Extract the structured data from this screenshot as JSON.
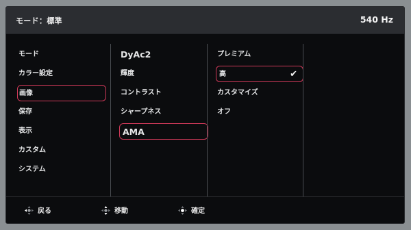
{
  "header": {
    "title": "モード：標準",
    "refresh": "540 Hz"
  },
  "col1": [
    {
      "label": "モード"
    },
    {
      "label": "カラー設定"
    },
    {
      "label": "画像"
    },
    {
      "label": "保存"
    },
    {
      "label": "表示"
    },
    {
      "label": "カスタム"
    },
    {
      "label": "システム"
    }
  ],
  "col2": [
    {
      "label": "DyAc2"
    },
    {
      "label": "輝度"
    },
    {
      "label": "コントラスト"
    },
    {
      "label": "シャープネス"
    },
    {
      "label": "AMA"
    }
  ],
  "col3": [
    {
      "label": "プレミアム"
    },
    {
      "label": "高"
    },
    {
      "label": "カスタマイズ"
    },
    {
      "label": "オフ"
    }
  ],
  "footer": {
    "back": "戻る",
    "move": "移動",
    "confirm": "確定"
  },
  "colors": {
    "highlight": "#d23a5a"
  },
  "icons": {
    "back": "dpad-left-icon",
    "move": "dpad-updown-icon",
    "confirm": "dpad-center-icon",
    "selected": "check-icon"
  }
}
